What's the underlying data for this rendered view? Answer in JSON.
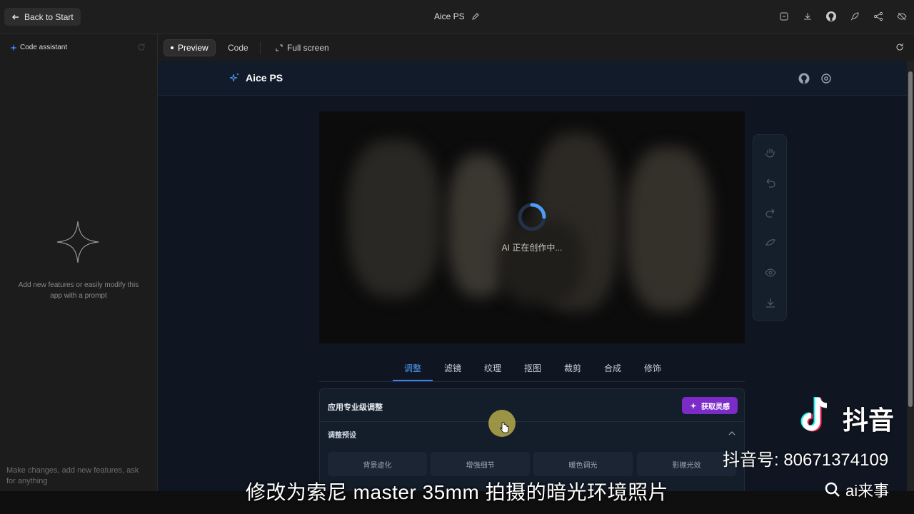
{
  "topbar": {
    "back_label": "Back to Start",
    "app_title": "Aice PS",
    "icons": [
      "save-icon",
      "download-icon",
      "github-icon",
      "rocket-icon",
      "share-icon",
      "hide-icon"
    ]
  },
  "sidebar": {
    "header": "Code assistant",
    "hint": "Add new features or easily modify this app with a prompt",
    "input_placeholder": "Make changes, add new features, ask for anything"
  },
  "view_tabs": {
    "preview": "Preview",
    "code": "Code",
    "fullscreen": "Full screen"
  },
  "app": {
    "name": "Aice PS",
    "loading_text": "AI 正在创作中...",
    "tools": [
      "hand-icon",
      "undo-icon",
      "redo-icon",
      "compare-icon",
      "eye-icon",
      "download-icon"
    ],
    "tabs": [
      "调整",
      "滤镜",
      "纹理",
      "抠图",
      "裁剪",
      "合成",
      "修饰"
    ],
    "active_tab": "调整",
    "panel": {
      "title": "应用专业级调整",
      "inspire_button": "获取灵感",
      "preset_section": "调整预设",
      "presets": [
        "背景虚化",
        "增强细节",
        "暖色调光",
        "影棚光效"
      ]
    }
  },
  "overlay": {
    "subtitle": "修改为索尼 master 35mm 拍摄的暗光环境照片",
    "platform_name": "抖音",
    "platform_id": "抖音号: 80671374109",
    "search_text": "ai来事"
  },
  "colors": {
    "accent": "#3b82f6",
    "inspire": "#7b2bc8",
    "app_bg": "#0f1622"
  }
}
